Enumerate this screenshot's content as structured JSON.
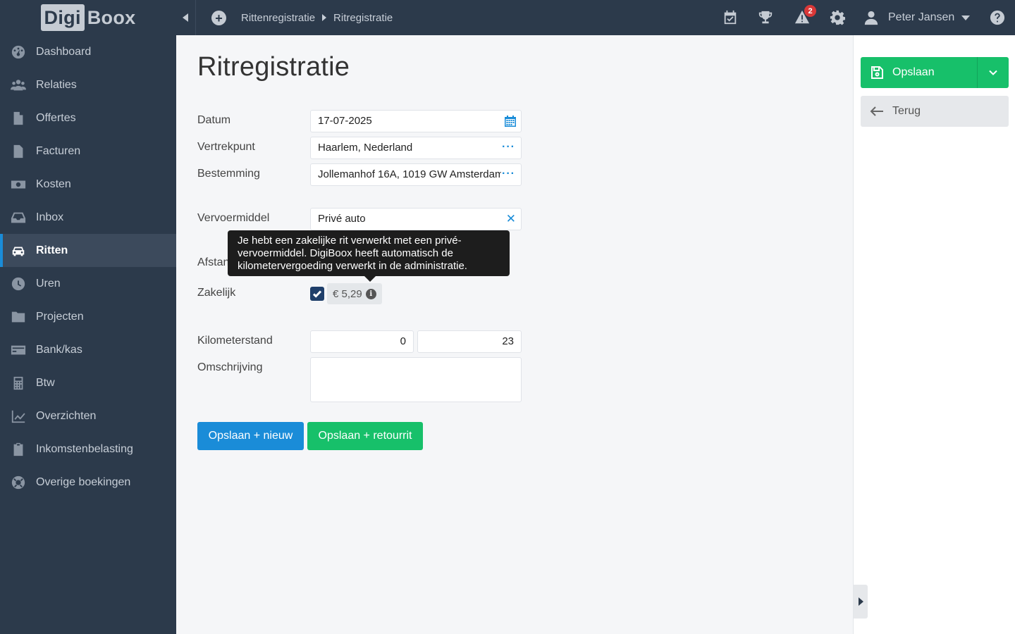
{
  "logo": {
    "part1": "Digi",
    "part2": "Boox"
  },
  "sidebar": {
    "items": [
      {
        "label": "Dashboard",
        "icon": "dashboard-icon"
      },
      {
        "label": "Relaties",
        "icon": "users-icon"
      },
      {
        "label": "Offertes",
        "icon": "file-icon"
      },
      {
        "label": "Facturen",
        "icon": "invoice-icon"
      },
      {
        "label": "Kosten",
        "icon": "money-icon"
      },
      {
        "label": "Inbox",
        "icon": "inbox-icon"
      },
      {
        "label": "Ritten",
        "icon": "car-icon",
        "active": true
      },
      {
        "label": "Uren",
        "icon": "clock-icon"
      },
      {
        "label": "Projecten",
        "icon": "folder-icon"
      },
      {
        "label": "Bank/kas",
        "icon": "credit-card-icon"
      },
      {
        "label": "Btw",
        "icon": "calculator-icon"
      },
      {
        "label": "Overzichten",
        "icon": "chart-line-icon"
      },
      {
        "label": "Inkomstenbelasting",
        "icon": "clipboard-icon"
      },
      {
        "label": "Overige boekingen",
        "icon": "lifebuoy-icon"
      }
    ]
  },
  "topbar": {
    "breadcrumb": [
      "Rittenregistratie",
      "Ritregistratie"
    ],
    "notification_count": "2",
    "user_name": "Peter Jansen"
  },
  "page": {
    "title": "Ritregistratie"
  },
  "form": {
    "datum_label": "Datum",
    "datum_value": "17-07-2025",
    "vertrekpunt_label": "Vertrekpunt",
    "vertrekpunt_value": "Haarlem, Nederland",
    "bestemming_label": "Bestemming",
    "bestemming_value": "Jollemanhof 16A, 1019 GW Amsterdam",
    "vervoermiddel_label": "Vervoermiddel",
    "vervoermiddel_value": "Privé auto",
    "afstand_label": "Afstand",
    "zakelijk_label": "Zakelijk",
    "zakelijk_checked": true,
    "amount": "€ 5,29",
    "kilometerstand_label": "Kilometerstand",
    "km_start": "0",
    "km_end": "23",
    "omschrijving_label": "Omschrijving",
    "omschrijving_value": ""
  },
  "tooltip": {
    "line1": "Je hebt een zakelijke rit verwerkt met een privé-",
    "line2": "vervoermiddel. DigiBoox heeft automatisch de",
    "line3": "kilometervergoeding verwerkt in de administratie."
  },
  "buttons": {
    "save_new": "Opslaan + nieuw",
    "save_return": "Opslaan + retourrit",
    "save": "Opslaan",
    "back": "Terug"
  },
  "colors": {
    "sidebar_bg": "#2c3a4b",
    "accent_blue": "#1a8cd8",
    "accent_green": "#17c06a",
    "badge_red": "#d93838"
  }
}
